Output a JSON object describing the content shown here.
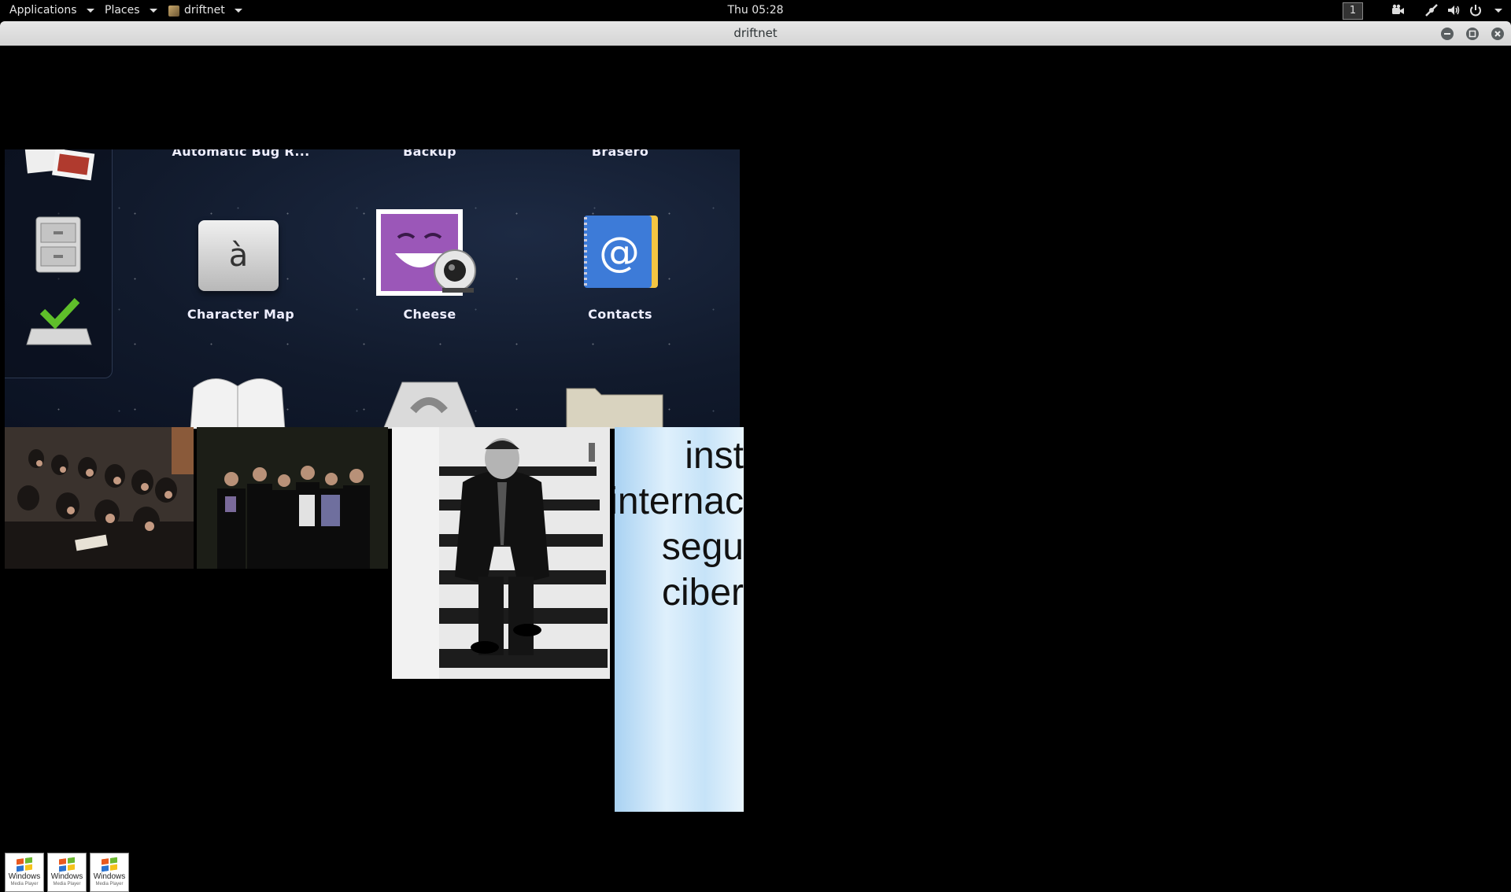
{
  "topbar": {
    "applications": "Applications",
    "places": "Places",
    "app_menu": "driftnet",
    "clock": "Thu 05:28",
    "workspace": "1"
  },
  "window": {
    "title": "driftnet"
  },
  "menu_screenshot": {
    "top_labels": [
      "Automatic Bug R...",
      "Backup",
      "Brasero"
    ],
    "apps": [
      {
        "label": "Character Map",
        "icon": "character-map-icon",
        "glyph": "à"
      },
      {
        "label": "Cheese",
        "icon": "cheese-icon"
      },
      {
        "label": "Contacts",
        "icon": "contacts-icon",
        "glyph": "@"
      }
    ]
  },
  "slide": {
    "text": "inst\ninternac\nsegu\nciber"
  },
  "thumbnails": [
    {
      "line1": "Windows",
      "line2": "Media Player"
    },
    {
      "line1": "Windows",
      "line2": "Media Player"
    },
    {
      "line1": "Windows",
      "line2": "Media Player"
    }
  ]
}
